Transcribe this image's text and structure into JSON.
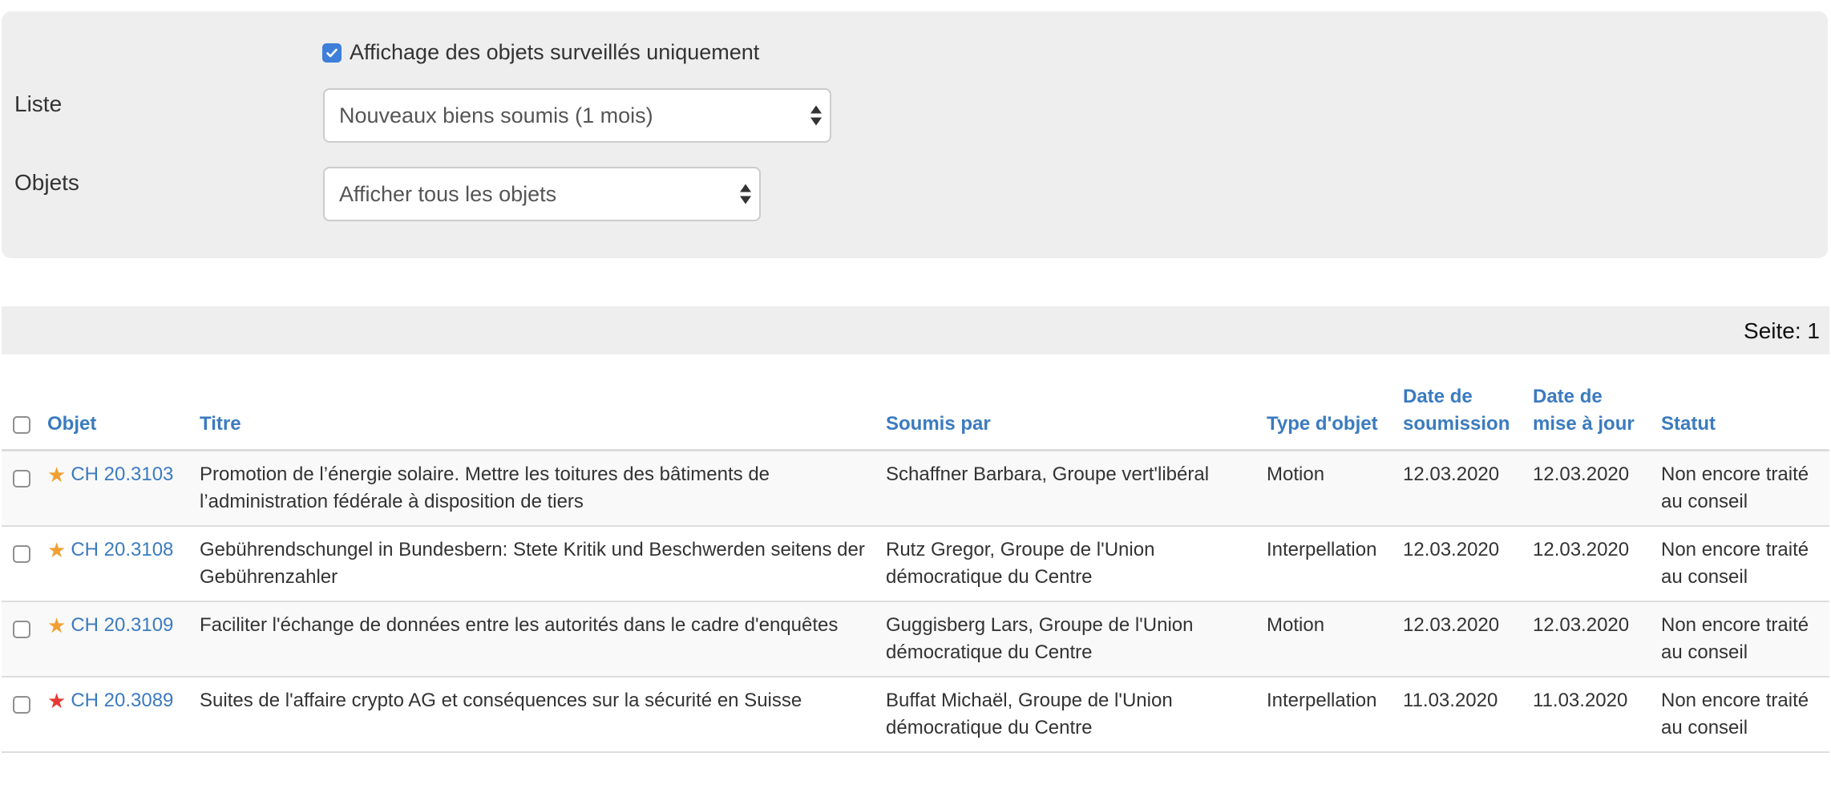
{
  "filters": {
    "watch_only_label": "Affichage des objets surveillés uniquement",
    "watch_only_checked": true,
    "list_label": "Liste",
    "list_value": "Nouveaux biens soumis (1 mois)",
    "objects_label": "Objets",
    "objects_value": "Afficher tous les objets"
  },
  "pager": {
    "text": "Seite: 1"
  },
  "table": {
    "headers": {
      "objet": "Objet",
      "titre": "Titre",
      "soumis_par": "Soumis par",
      "type": "Type d'objet",
      "date_soumission_1": "Date de",
      "date_soumission_2": "soumission",
      "date_maj_1": "Date de",
      "date_maj_2": "mise à jour",
      "statut": "Statut"
    },
    "colors": {
      "star_watched": "#f0a030",
      "star_important": "#e53935",
      "link": "#3b7bbf"
    },
    "rows": [
      {
        "star": "★",
        "star_color": "#f0a030",
        "objet": "CH 20.3103",
        "titre": "Promotion de l’énergie solaire. Mettre les toitures des bâtiments de l’administration fédérale à disposition de tiers",
        "soumis_par": "Schaffner Barbara, Groupe vert'libéral",
        "type": "Motion",
        "date_soumission": "12.03.2020",
        "date_maj": "12.03.2020",
        "statut": "Non encore traité au conseil"
      },
      {
        "star": "★",
        "star_color": "#f0a030",
        "objet": "CH 20.3108",
        "titre": "Gebührendschungel in Bundesbern: Stete Kritik und Beschwerden seitens der Gebührenzahler",
        "soumis_par": "Rutz Gregor, Groupe de l'Union démocratique du Centre",
        "type": "Interpellation",
        "date_soumission": "12.03.2020",
        "date_maj": "12.03.2020",
        "statut": "Non encore traité au conseil"
      },
      {
        "star": "★",
        "star_color": "#f0a030",
        "objet": "CH 20.3109",
        "titre": "Faciliter l'échange de données entre les autorités dans le cadre d'enquêtes",
        "soumis_par": "Guggisberg Lars, Groupe de l'Union démocratique du Centre",
        "type": "Motion",
        "date_soumission": "12.03.2020",
        "date_maj": "12.03.2020",
        "statut": "Non encore traité au conseil"
      },
      {
        "star": "★",
        "star_color": "#e53935",
        "objet": "CH 20.3089",
        "titre": "Suites de l'affaire crypto AG et conséquences sur la sécurité en Suisse",
        "soumis_par": "Buffat Michaël, Groupe de l'Union démocratique du Centre",
        "type": "Interpellation",
        "date_soumission": "11.03.2020",
        "date_maj": "11.03.2020",
        "statut": "Non encore traité au conseil"
      }
    ]
  }
}
